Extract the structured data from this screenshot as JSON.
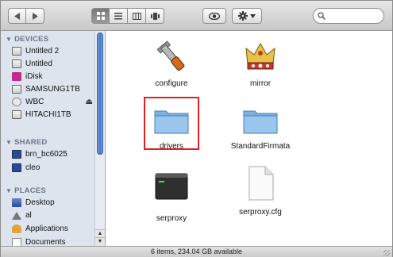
{
  "toolbar": {
    "view_modes": [
      "icon-view",
      "list-view",
      "column-view",
      "coverflow-view"
    ],
    "active_view": "icon-view"
  },
  "search": {
    "placeholder": ""
  },
  "sidebar": {
    "devices_header": "DEVICES",
    "devices": [
      {
        "label": "Untitled 2",
        "icon": "disk-icon"
      },
      {
        "label": "Untitled",
        "icon": "disk-icon"
      },
      {
        "label": "iDisk",
        "icon": "idisk-icon"
      },
      {
        "label": "SAMSUNG1TB",
        "icon": "disk-icon"
      },
      {
        "label": "WBC",
        "icon": "network-disk-icon"
      },
      {
        "label": "HITACHI1TB",
        "icon": "disk-icon"
      }
    ],
    "shared_header": "SHARED",
    "shared": [
      {
        "label": "brn_bc6025",
        "icon": "monitor-icon"
      },
      {
        "label": "cleo",
        "icon": "monitor-icon"
      }
    ],
    "places_header": "PLACES",
    "places": [
      {
        "label": "Desktop",
        "icon": "desktop-icon"
      },
      {
        "label": "al",
        "icon": "home-icon"
      },
      {
        "label": "Applications",
        "icon": "applications-icon"
      },
      {
        "label": "Documents",
        "icon": "documents-icon"
      }
    ]
  },
  "files": [
    {
      "name": "configure",
      "icon": "executable-tool-icon"
    },
    {
      "name": "mirror",
      "icon": "crown-app-icon"
    },
    {
      "name": "drivers",
      "icon": "folder-icon"
    },
    {
      "name": "StandardFirmata",
      "icon": "folder-icon"
    },
    {
      "name": "serproxy",
      "icon": "terminal-executable-icon"
    },
    {
      "name": "serproxy.cfg",
      "icon": "document-icon"
    }
  ],
  "selected_file": "drivers",
  "status": {
    "text": "6 items, 234.04 GB available"
  },
  "colors": {
    "highlight": "#e02020",
    "sidebar_bg": "#dde4ee",
    "folder": "#8fbde8"
  }
}
